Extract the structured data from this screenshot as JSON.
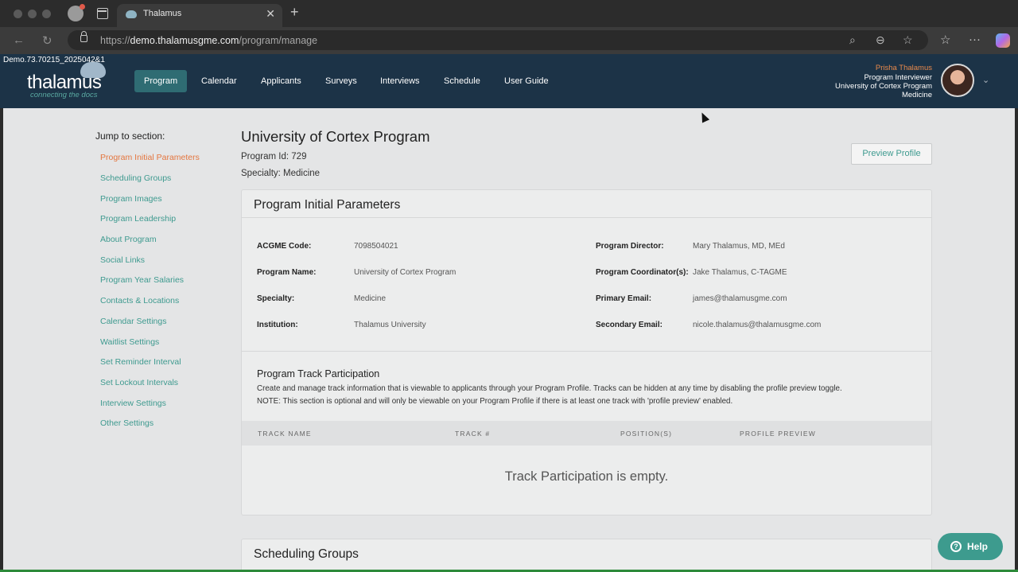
{
  "browser": {
    "tab_title": "Thalamus",
    "url_prefix": "https://",
    "url_host": "demo.thalamusgme.com",
    "url_path": "/program/manage"
  },
  "app": {
    "build": "Demo.73.70215_2025042&1",
    "logo_text": "thalamus",
    "tagline": "connecting the docs",
    "nav": [
      "Program",
      "Calendar",
      "Applicants",
      "Surveys",
      "Interviews",
      "Schedule",
      "User Guide"
    ],
    "user": {
      "name": "Prisha Thalamus",
      "role": "Program Interviewer",
      "program": "University of Cortex Program",
      "specialty": "Medicine"
    }
  },
  "sidebar": {
    "title": "Jump to section:",
    "links": [
      "Program Initial Parameters",
      "Scheduling Groups",
      "Program Images",
      "Program Leadership",
      "About Program",
      "Social Links",
      "Program Year Salaries",
      "Contacts & Locations",
      "Calendar Settings",
      "Waitlist Settings",
      "Set Reminder Interval",
      "Set Lockout Intervals",
      "Interview Settings",
      "Other Settings"
    ]
  },
  "program": {
    "title": "University of Cortex Program",
    "id_line": "Program Id: 729",
    "specialty_line": "Specialty: Medicine",
    "preview_button": "Preview Profile"
  },
  "params": {
    "title": "Program Initial Parameters",
    "left": [
      {
        "label": "ACGME Code:",
        "value": "7098504021"
      },
      {
        "label": "Program Name:",
        "value": "University of Cortex Program"
      },
      {
        "label": "Specialty:",
        "value": "Medicine"
      },
      {
        "label": "Institution:",
        "value": "Thalamus University"
      }
    ],
    "right": [
      {
        "label": "Program Director:",
        "value": "Mary Thalamus, MD, MEd"
      },
      {
        "label": "Program Coordinator(s):",
        "value": "Jake Thalamus, C-TAGME"
      },
      {
        "label": "Primary Email:",
        "value": "james@thalamusgme.com"
      },
      {
        "label": "Secondary Email:",
        "value": "nicole.thalamus@thalamusgme.com"
      }
    ]
  },
  "tracks": {
    "title": "Program Track Participation",
    "desc1": "Create and manage track information that is viewable to applicants through your Program Profile. Tracks can be hidden at any time by disabling the profile preview toggle.",
    "desc2": "NOTE: This section is optional and will only be viewable on your Program Profile if there is at least one track with 'profile preview' enabled.",
    "columns": [
      "TRACK NAME",
      "TRACK #",
      "POSITION(S)",
      "PROFILE PREVIEW"
    ],
    "empty": "Track Participation is empty."
  },
  "scheduling": {
    "title": "Scheduling Groups"
  },
  "help": {
    "label": "Help"
  }
}
